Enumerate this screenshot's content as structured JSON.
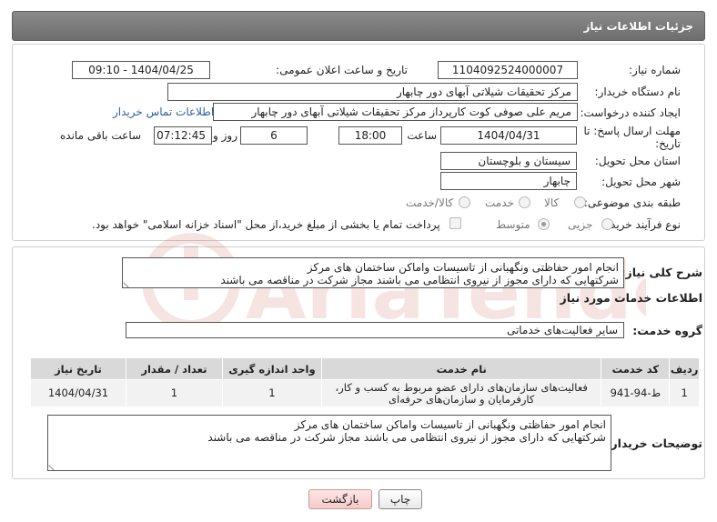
{
  "header": {
    "title": "جزئیات اطلاعات نیاز"
  },
  "form": {
    "need_number_label": "شماره نیاز:",
    "need_number": "1104092524000007",
    "announce_label": "تاریخ و ساعت اعلان عمومی:",
    "announce_value": "1404/04/25 - 09:10",
    "buyer_org_label": "نام دستگاه خریدار:",
    "buyer_org": "مرکز تحقیقات شیلاتی آبهای دور چابهار",
    "creator_label": "ایجاد کننده درخواست:",
    "creator": "مریم علی صوفی کوت کارپرداز مرکز تحقیقات شیلاتی آبهای دور چابهار",
    "contact_link": "اطلاعات تماس خریدار",
    "deadline_label": "مهلت ارسال پاسخ: تا تاریخ:",
    "deadline_date": "1404/04/31",
    "time_label": "ساعت",
    "deadline_time": "18:00",
    "days_value": "6",
    "days_label": "روز و",
    "remaining_time": "07:12:45",
    "remaining_label": "ساعت باقی مانده",
    "province_label": "استان محل تحویل:",
    "province": "سیستان و بلوچستان",
    "city_label": "شهر محل تحویل:",
    "city": "چابهار",
    "category_label": "طبقه بندی موضوعی:",
    "category_options": [
      "کالا",
      "خدمت",
      "کالا/خدمت"
    ],
    "process_label": "نوع فرآیند خرید :",
    "process_options": [
      "جزیی",
      "متوسط"
    ],
    "payment_note": "پرداخت تمام یا بخشی از مبلغ خرید،از محل \"اسناد خزانه اسلامی\" خواهد بود."
  },
  "details": {
    "summary_label": "شرح کلی نیاز:",
    "summary_line1": "انجام امور حفاظتی ونگهبانی از تاسیسات واماکن ساختمان های مرکز",
    "summary_line2": "شرکتهایی که دارای مجوز از نیروی انتظامی می باشند مجاز شرکت در مناقصه می باشند",
    "services_title": "اطلاعات خدمات مورد نیاز",
    "service_group_label": "گروه خدمت:",
    "service_group": "سایر فعالیت‌های خدماتی",
    "table": {
      "headers": [
        "ردیف",
        "کد خدمت",
        "نام خدمت",
        "واحد اندازه گیری",
        "تعداد / مقدار",
        "تاریخ نیاز"
      ],
      "rows": [
        {
          "row": "1",
          "code": "ط-94-941",
          "name_line1": "فعالیت‌های سازمان‌های دارای عضو مربوط به کسب و کار،",
          "name_line2": "کارفرمایان و سازمان‌های حرفه‌ای",
          "unit": "1",
          "qty": "1",
          "date": "1404/04/31"
        }
      ]
    },
    "buyer_notes_label": "توضیحات خریدار:",
    "buyer_notes_line1": "انجام امور حفاظتی ونگهبانی از تاسیسات واماکن ساختمان های مرکز",
    "buyer_notes_line2": "شرکتهایی که دارای مجوز از نیروی انتظامی می باشند مجاز شرکت در مناقصه می باشند"
  },
  "buttons": {
    "print": "چاپ",
    "back": "بازگشت"
  },
  "colors": {
    "header_bg": "#7a7a7a",
    "link": "#2d62a8",
    "back_button": "#f6c9c9"
  }
}
